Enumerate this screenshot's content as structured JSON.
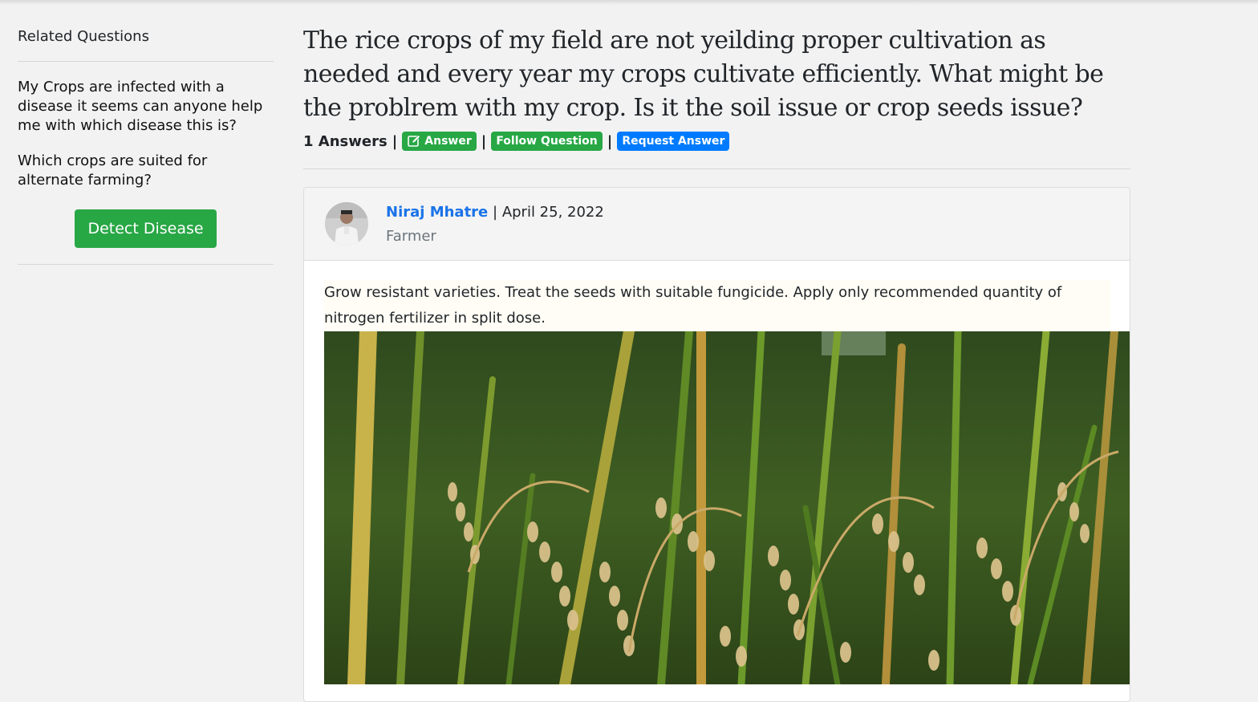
{
  "sidebar": {
    "title": "Related Questions",
    "items": [
      {
        "label": "My Crops are infected with a disease it seems can anyone help me with which disease this is?"
      },
      {
        "label": "Which crops are suited for alternate farming?"
      }
    ],
    "detect_button": "Detect Disease"
  },
  "question": {
    "title": "The rice crops of my field are not yeilding proper cultivation as needed and every year my crops cultivate efficiently. What might be the problrem with my crop. Is it the soil issue or crop seeds issue?",
    "answers_count": "1 Answers",
    "separator": "|",
    "answer_button": "Answer",
    "follow_button": "Follow Question",
    "request_button": "Request Answer"
  },
  "answer": {
    "author": "Niraj Mhatre",
    "separator": "|",
    "date": "April 25, 2022",
    "role": "Farmer",
    "text": "Grow resistant varieties. Treat the seeds with suitable fungicide. Apply only recommended quantity of nitrogen fertilizer in split dose."
  },
  "colors": {
    "green": "#28a745",
    "blue": "#007bff",
    "link": "#1a73e8"
  },
  "icons": {
    "answer": "edit-icon"
  }
}
